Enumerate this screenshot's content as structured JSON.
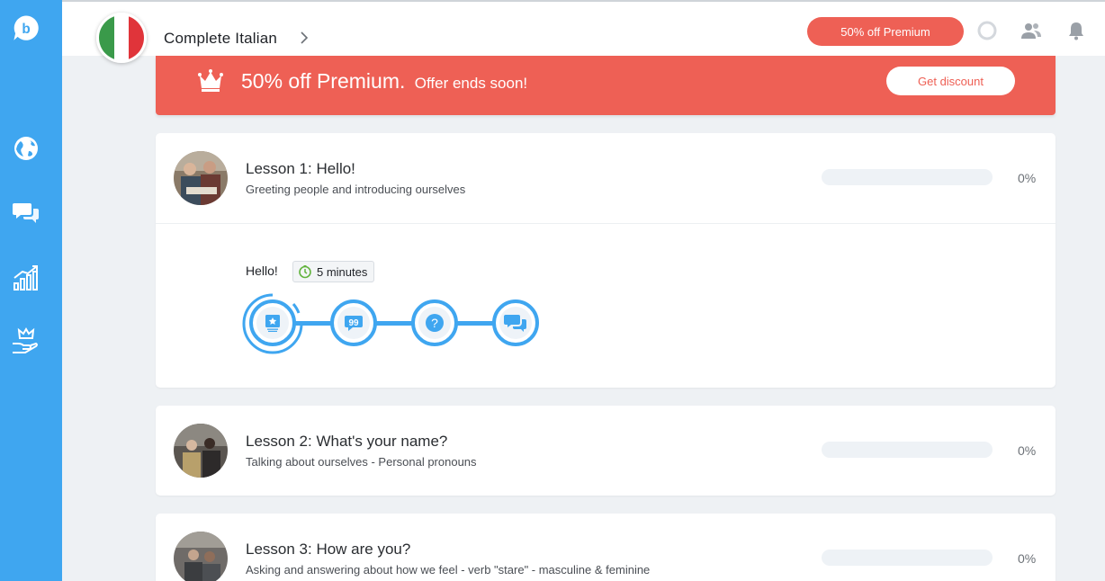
{
  "header": {
    "course_title": "Complete Italian",
    "premium_pill": "50% off Premium"
  },
  "banner": {
    "title": "50% off Premium.",
    "subtitle": "Offer ends soon!",
    "button": "Get discount"
  },
  "sidebar": {
    "items": [
      {
        "icon": "logo-icon"
      },
      {
        "icon": "globe-icon"
      },
      {
        "icon": "chat-icon"
      },
      {
        "icon": "progress-chart-icon"
      },
      {
        "icon": "premium-crown-hand-icon"
      }
    ]
  },
  "lessons": [
    {
      "title": "Lesson 1: Hello!",
      "description": "Greeting people and introducing ourselves",
      "progress_text": "0%",
      "progress_value": 0,
      "expanded": true,
      "unit": {
        "title": "Hello!",
        "duration": "5 minutes",
        "steps": [
          "flashcard-icon",
          "quote-icon",
          "question-icon",
          "conversation-icon"
        ]
      }
    },
    {
      "title": "Lesson 2: What's your name?",
      "description": "Talking about ourselves - Personal pronouns",
      "progress_text": "0%",
      "progress_value": 0
    },
    {
      "title": "Lesson 3: How are you?",
      "description": "Asking and answering about how we feel - verb \"stare\" - masculine & feminine",
      "progress_text": "0%",
      "progress_value": 0
    }
  ],
  "colors": {
    "accent": "#3fa6f0",
    "promo": "#ee6055",
    "flag_green": "#3a9a4a",
    "flag_white": "#ffffff",
    "flag_red": "#e0343a"
  }
}
